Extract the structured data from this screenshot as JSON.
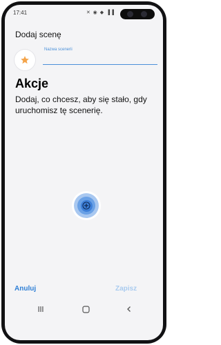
{
  "status": {
    "time": "17:41",
    "icons": "✕ ◉ ◆ ▐▐"
  },
  "header": {
    "title": "Dodaj scenę"
  },
  "scene_name": {
    "label": "Nazwa scenerii",
    "value": "",
    "icon": "star-icon"
  },
  "actions": {
    "title": "Akcje",
    "description": "Dodaj, co chcesz, aby się stało, gdy uruchomisz tę scenerię.",
    "add_icon": "plus-icon"
  },
  "footer": {
    "cancel": "Anuluj",
    "save": "Zapisz"
  },
  "navbar": {
    "items": [
      "recents-icon",
      "home-icon",
      "back-icon"
    ]
  },
  "colors": {
    "accent": "#2e7fd6",
    "disabled": "#a9cbef",
    "star": "#f4a44a"
  }
}
